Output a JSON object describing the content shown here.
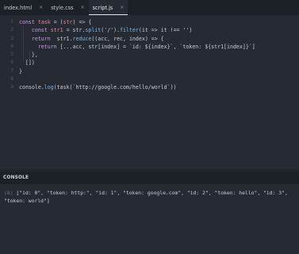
{
  "tabs": [
    {
      "label": "index.html",
      "close": "×",
      "active": false
    },
    {
      "label": "style.css",
      "close": "×",
      "active": false
    },
    {
      "label": "script.js",
      "close": "×",
      "active": true
    }
  ],
  "editor": {
    "line_numbers": [
      "1",
      "2",
      "3",
      "4",
      "5",
      "6",
      "7",
      "8",
      "9"
    ],
    "lines": [
      [
        {
          "t": "const ",
          "c": "kw"
        },
        {
          "t": "task",
          "c": "var"
        },
        {
          "t": " = (",
          "c": "pun"
        },
        {
          "t": "str",
          "c": "var"
        },
        {
          "t": ") => {",
          "c": "pun"
        }
      ],
      [
        {
          "t": "    const ",
          "c": "kw"
        },
        {
          "t": "str1",
          "c": "var"
        },
        {
          "t": " = str.",
          "c": "pun"
        },
        {
          "t": "split",
          "c": "fn"
        },
        {
          "t": "('/').",
          "c": "pun"
        },
        {
          "t": "filter",
          "c": "fn"
        },
        {
          "t": "(it => it !== '')",
          "c": "pun"
        }
      ],
      [
        {
          "t": "    return ",
          "c": "kw"
        },
        {
          "t": " str1.",
          "c": "pun"
        },
        {
          "t": "reduce",
          "c": "fn"
        },
        {
          "t": "((acc, rec, index) => {",
          "c": "pun"
        }
      ],
      [
        {
          "t": "      return ",
          "c": "kw"
        },
        {
          "t": "[...acc, str[index] = `id: ${index}`, `token: ${str1[index]}`]",
          "c": "pun"
        }
      ],
      [
        {
          "t": "    },",
          "c": "pun"
        }
      ],
      [
        {
          "t": "  [])",
          "c": "pun"
        }
      ],
      [
        {
          "t": "}",
          "c": "pun"
        }
      ],
      [
        {
          "t": "",
          "c": "pun"
        }
      ],
      [
        {
          "t": "console.",
          "c": "pun"
        },
        {
          "t": "log",
          "c": "fn"
        },
        {
          "t": "(task(`http://google.com/hello/world`))",
          "c": "pun"
        }
      ]
    ]
  },
  "console": {
    "title": "CONSOLE",
    "count": "(8)",
    "output": "[\"id: 0\", \"token: http:\", \"id: 1\", \"token: google.com\", \"id: 2\", \"token: hello\", \"id: 3\", \"token: world\"]"
  }
}
